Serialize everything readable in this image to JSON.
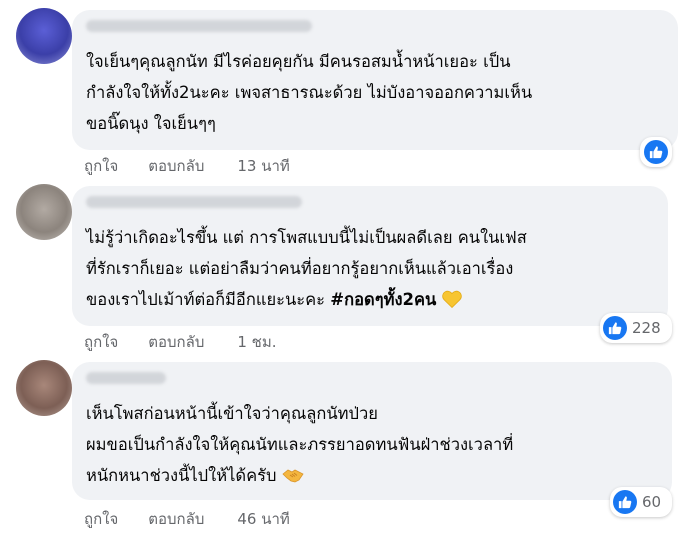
{
  "comments": [
    {
      "lines": [
        "ใจเย็นๆคุณลูกนัท มีไรค่อยคุยกัน มีคนรอสมน้ำหน้าเยอะ เป็น",
        "กำลังใจให้ทั้ง2นะคะ เพจสาธารณะด้วย ไม่บังอาจออกความเห็น",
        "ขอนิ๊ดนุง ใจเย็นๆๆ"
      ],
      "like_label": "ถูกใจ",
      "reply_label": "ตอบกลับ",
      "time": "13 นาที",
      "reaction_count": ""
    },
    {
      "lines": [
        "ไม่รู้ว่าเกิดอะไรขึ้น แต่ การโพสแบบนี้ไม่เป็นผลดีเลย คนในเฟส",
        "ที่รักเราก็เยอะ แต่อย่าลืมว่าคนที่อยากรู้อยากเห็นแล้วเอาเรื่อง",
        "ของเราไปเม้าท์ต่อก็มีอีกแยะนะคะ"
      ],
      "hashtag": "#กอดๆทั้ง2คน",
      "like_label": "ถูกใจ",
      "reply_label": "ตอบกลับ",
      "time": "1 ชม.",
      "reaction_count": "228"
    },
    {
      "lines": [
        "เห็นโพสก่อนหน้านี้เข้าใจว่าคุณลูกนัทป่วย",
        "ผมขอเป็นกำลังใจให้คุณนัทและภรรยาอดทนฟันฝ่าช่วงเวลาที่",
        "หนักหนาช่วงนี้ไปให้ได้ครับ"
      ],
      "like_label": "ถูกใจ",
      "reply_label": "ตอบกลับ",
      "time": "46 นาที",
      "reaction_count": "60"
    }
  ],
  "icons": {
    "reaction": "like-thumbs-up-icon",
    "emoji_2": "yellow-heart-icon",
    "emoji_3": "handshake-icon"
  },
  "colors": {
    "bubble": "#f0f2f5",
    "like_blue": "#1877f2",
    "meta_text": "#65676b",
    "heart": "#f7c531"
  }
}
